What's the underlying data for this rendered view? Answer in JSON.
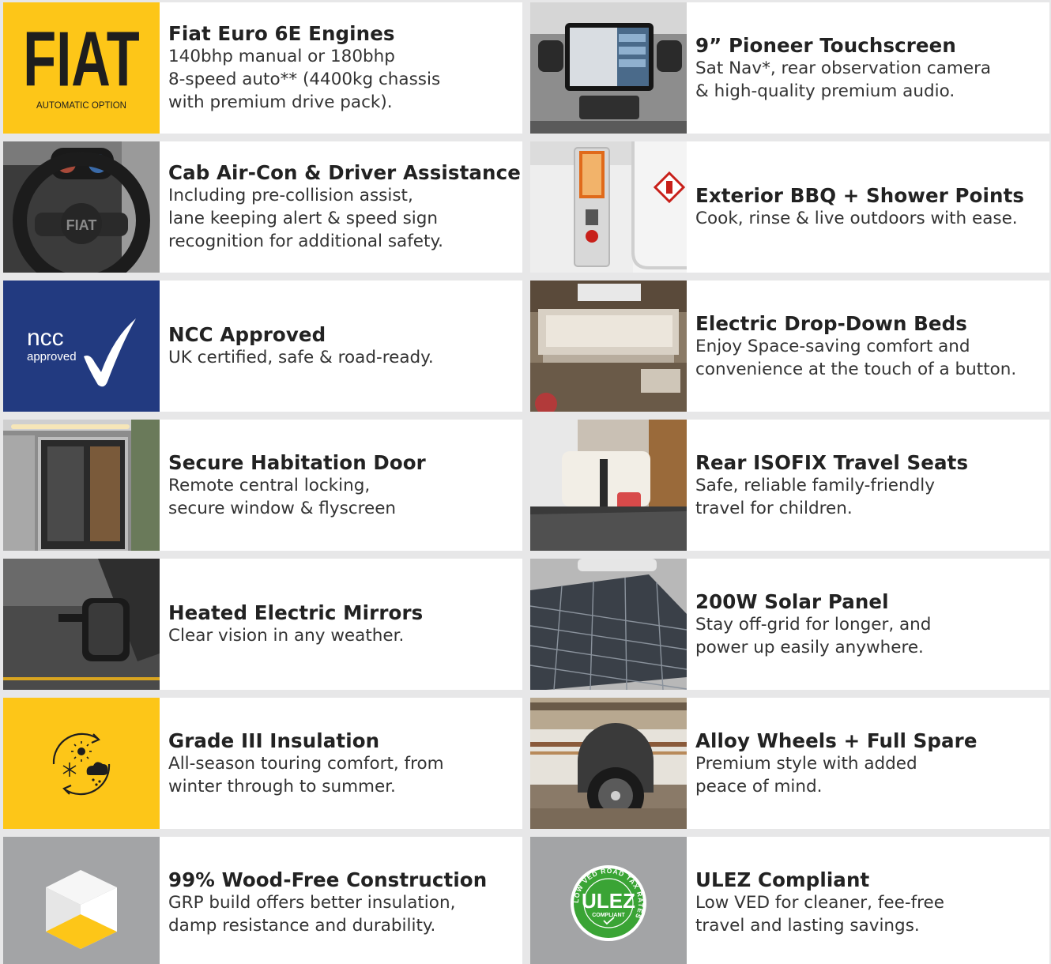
{
  "colors": {
    "accent_yellow": "#fdc618",
    "ncc_blue": "#223a80",
    "grey_tile": "#a3a4a6",
    "ulez_green": "#3aa435"
  },
  "features": [
    {
      "title": "Fiat Euro 6E Engines",
      "desc": "140bhp manual or 180bhp\n8-speed auto** (4400kg chassis\nwith premium drive pack).",
      "logo_text": "FIAT",
      "logo_caption": "AUTOMATIC OPTION",
      "icon": "fiat-logo-icon"
    },
    {
      "title": "9” Pioneer Touchscreen",
      "desc": "Sat Nav*, rear observation camera\n& high-quality premium audio.",
      "icon": "touchscreen-photo"
    },
    {
      "title": "Cab Air-Con & Driver Assistance",
      "desc": "Including pre-collision assist,\nlane keeping alert & speed sign\nrecognition for additional safety.",
      "icon": "steering-wheel-photo"
    },
    {
      "title": "Exterior BBQ + Shower Points",
      "desc": "Cook, rinse & live outdoors with ease.",
      "icon": "exterior-points-photo"
    },
    {
      "title": "NCC Approved",
      "desc": "UK certified, safe & road-ready.",
      "logo_text": "ncc",
      "logo_caption": "approved",
      "icon": "ncc-approved-icon"
    },
    {
      "title": "Electric Drop-Down Beds",
      "desc": "Enjoy Space-saving comfort and\nconvenience at the touch of a button.",
      "icon": "drop-down-bed-photo"
    },
    {
      "title": "Secure Habitation Door",
      "desc": "Remote central locking,\nsecure window & flyscreen",
      "icon": "habitation-door-photo"
    },
    {
      "title": "Rear ISOFIX Travel Seats",
      "desc": "Safe, reliable family-friendly\ntravel for children.",
      "icon": "isofix-seats-photo"
    },
    {
      "title": "Heated Electric Mirrors",
      "desc": "Clear vision in any weather.",
      "icon": "mirror-photo"
    },
    {
      "title": "200W Solar Panel",
      "desc": "Stay off-grid for longer, and\npower up easily anywhere.",
      "icon": "solar-panel-photo"
    },
    {
      "title": "Grade III Insulation",
      "desc": "All-season touring comfort, from\nwinter through to summer.",
      "icon": "all-season-icon"
    },
    {
      "title": "Alloy Wheels + Full Spare",
      "desc": "Premium style with added\npeace of mind.",
      "icon": "alloy-wheel-photo"
    },
    {
      "title": "99% Wood-Free Construction",
      "desc": "GRP build offers better insulation,\ndamp resistance and durability.",
      "icon": "cube-icon"
    },
    {
      "title": "ULEZ Compliant",
      "desc": "Low VED for cleaner, fee-free\ntravel and lasting savings.",
      "logo_text": "ULEZ",
      "logo_caption": "COMPLIANT",
      "logo_ring_text": "LOW VED ROAD TAX RATES",
      "icon": "ulez-badge-icon"
    }
  ]
}
